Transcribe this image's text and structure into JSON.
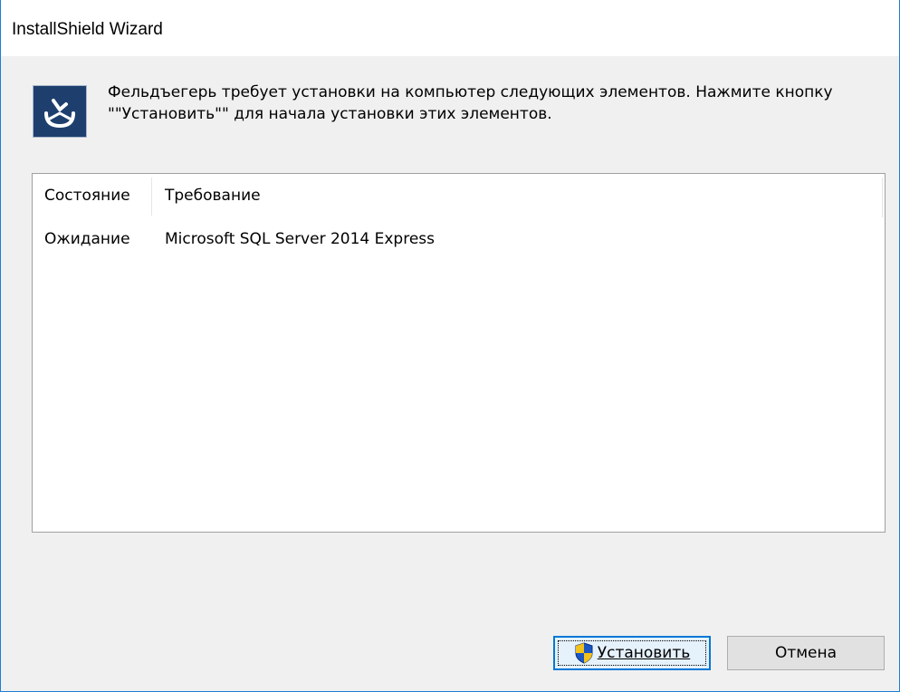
{
  "window": {
    "title": "InstallShield Wizard"
  },
  "header": {
    "icon": "installshield-app-icon",
    "message": "Фельдъегерь требует установки на компьютер следующих элементов. Нажмите кнопку \"\"Установить\"\" для начала установки этих элементов."
  },
  "requirements_list": {
    "columns": [
      "Состояние",
      "Требование"
    ],
    "rows": [
      {
        "status": "Ожидание",
        "requirement": "Microsoft SQL Server 2014 Express"
      }
    ]
  },
  "buttons": {
    "install_label": "Установить",
    "install_icon": "uac-shield-icon",
    "cancel_label": "Отмена"
  },
  "colors": {
    "window_border": "#1e7fd4",
    "dialog_background": "#f0f0f0",
    "default_button_border": "#0078d7",
    "app_icon_background": "#1e3f6e"
  }
}
